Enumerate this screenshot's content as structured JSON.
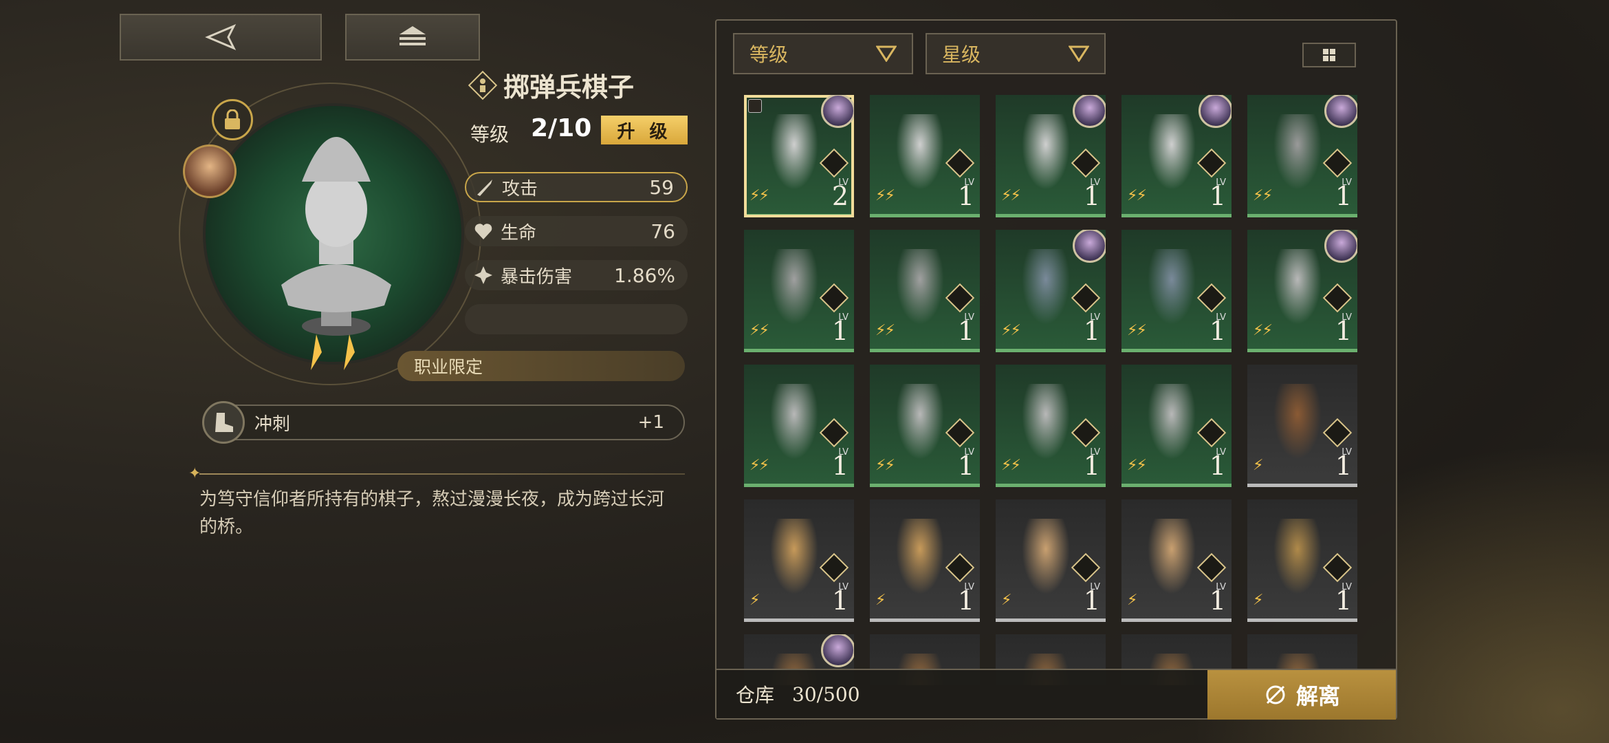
{
  "nav": {
    "back_icon": "back-triangle-icon",
    "home_icon": "home-layers-icon"
  },
  "item": {
    "title": "掷弹兵棋子",
    "level_label": "等级",
    "level_value": "2/10",
    "upgrade_label": "升 级",
    "stats": [
      {
        "label": "攻击",
        "value": "59",
        "icon": "sword-icon"
      },
      {
        "label": "生命",
        "value": "76",
        "icon": "heart-icon"
      },
      {
        "label": "暴击伤害",
        "value": "1.86%",
        "icon": "crit-icon"
      }
    ],
    "class_limit": "职业限定",
    "skill": {
      "label": "冲刺",
      "value": "+1",
      "icon": "boot-icon"
    },
    "description": "为笃守信仰者所持有的棋子，熬过漫漫长夜，成为跨过长河的桥。"
  },
  "inventory": {
    "sort_level": "等级",
    "sort_star": "星级",
    "storage_label": "仓库",
    "storage_count": "30/500",
    "dismantle_label": "解离",
    "cards": [
      {
        "lv": "2",
        "rarity": "green",
        "sparks": 2,
        "owner": true,
        "locked": true,
        "selected": true,
        "figure": "bust"
      },
      {
        "lv": "1",
        "rarity": "green",
        "sparks": 2,
        "owner": false,
        "figure": "bust"
      },
      {
        "lv": "1",
        "rarity": "green",
        "sparks": 2,
        "owner": true,
        "figure": "bust"
      },
      {
        "lv": "1",
        "rarity": "green",
        "sparks": 2,
        "owner": true,
        "figure": "bust"
      },
      {
        "lv": "1",
        "rarity": "green",
        "sparks": 2,
        "owner": true,
        "figure": "cat"
      },
      {
        "lv": "1",
        "rarity": "green",
        "sparks": 2,
        "owner": false,
        "figure": "bird"
      },
      {
        "lv": "1",
        "rarity": "green",
        "sparks": 2,
        "owner": false,
        "figure": "bird"
      },
      {
        "lv": "1",
        "rarity": "green",
        "sparks": 2,
        "owner": true,
        "figure": "painting"
      },
      {
        "lv": "1",
        "rarity": "green",
        "sparks": 2,
        "owner": false,
        "figure": "painting"
      },
      {
        "lv": "1",
        "rarity": "green",
        "sparks": 2,
        "owner": true,
        "figure": "key"
      },
      {
        "lv": "1",
        "rarity": "green",
        "sparks": 2,
        "owner": false,
        "figure": "key"
      },
      {
        "lv": "1",
        "rarity": "green",
        "sparks": 2,
        "owner": false,
        "figure": "key"
      },
      {
        "lv": "1",
        "rarity": "green",
        "sparks": 2,
        "owner": false,
        "figure": "key"
      },
      {
        "lv": "1",
        "rarity": "green",
        "sparks": 2,
        "owner": false,
        "figure": "key"
      },
      {
        "lv": "1",
        "rarity": "dark",
        "sparks": 1,
        "owner": false,
        "figure": "bronze-bust"
      },
      {
        "lv": "1",
        "rarity": "dark",
        "sparks": 1,
        "owner": false,
        "figure": "wood-cat"
      },
      {
        "lv": "1",
        "rarity": "dark",
        "sparks": 1,
        "owner": false,
        "figure": "wood-cat"
      },
      {
        "lv": "1",
        "rarity": "dark",
        "sparks": 1,
        "owner": false,
        "figure": "wood-fox"
      },
      {
        "lv": "1",
        "rarity": "dark",
        "sparks": 1,
        "owner": false,
        "figure": "wood-fox"
      },
      {
        "lv": "1",
        "rarity": "dark",
        "sparks": 1,
        "owner": false,
        "figure": "wood-owl"
      },
      {
        "lv": "",
        "rarity": "dark",
        "sparks": 0,
        "owner": true,
        "figure": "partial"
      },
      {
        "lv": "",
        "rarity": "dark",
        "sparks": 0,
        "owner": false,
        "figure": "partial"
      },
      {
        "lv": "",
        "rarity": "dark",
        "sparks": 0,
        "owner": false,
        "figure": "partial"
      },
      {
        "lv": "",
        "rarity": "dark",
        "sparks": 0,
        "owner": false,
        "figure": "partial"
      },
      {
        "lv": "",
        "rarity": "dark",
        "sparks": 0,
        "owner": false,
        "figure": "partial"
      }
    ]
  },
  "colors": {
    "accent_gold": "#d9a73a",
    "green_rarity": "#6bb06f",
    "dark_rarity": "#bbbbbb"
  }
}
